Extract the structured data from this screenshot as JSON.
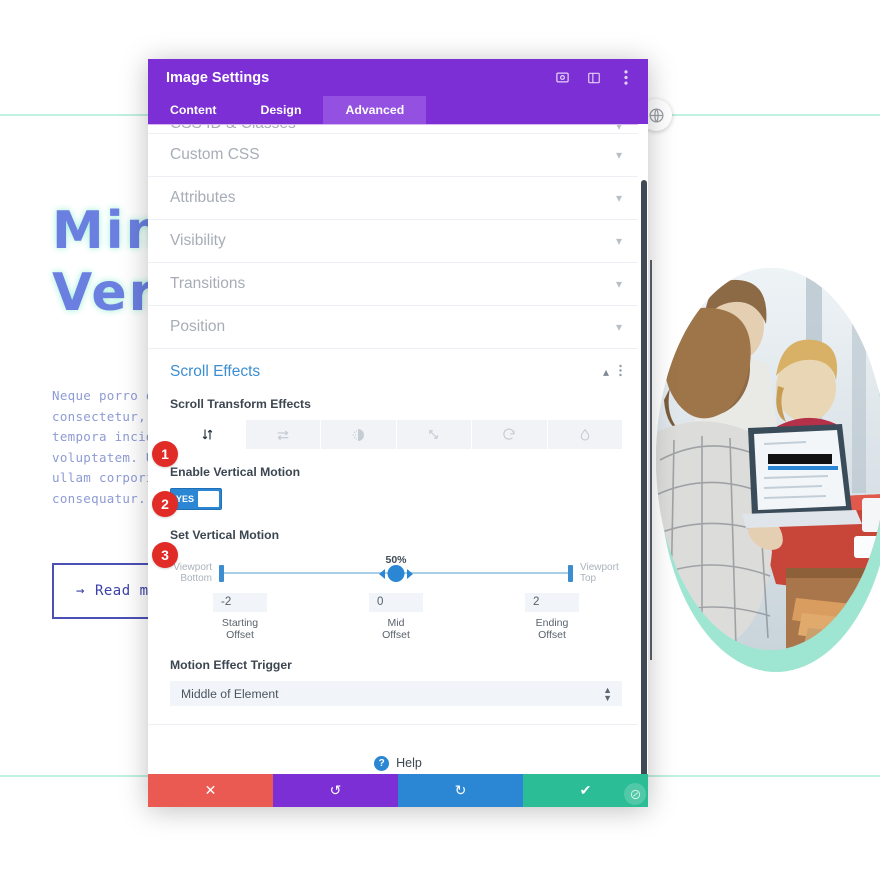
{
  "page": {
    "hero_title": "Min\nVer",
    "hero_body": "Neque porro qui\nconsectetur, ad\ntempora incidun\nvoluptatem. Ut\nullam corporis\nconsequatur.",
    "read_more_label": "Read  mo",
    "read_more_arrow": "→",
    "globe_icon": "globe-icon",
    "accent_mint": "#9fe6d2",
    "accent_indigo": "#6b7fe0"
  },
  "modal": {
    "title": "Image Settings",
    "header_icons": [
      "target-icon",
      "layout-icon",
      "kebab-menu-icon"
    ],
    "tabs": [
      {
        "label": "Content",
        "active": false
      },
      {
        "label": "Design",
        "active": false
      },
      {
        "label": "Advanced",
        "active": true
      }
    ],
    "sections": [
      {
        "label": "CSS ID & Classes",
        "state": "collapsed"
      },
      {
        "label": "Custom CSS",
        "state": "collapsed"
      },
      {
        "label": "Attributes",
        "state": "collapsed"
      },
      {
        "label": "Visibility",
        "state": "collapsed"
      },
      {
        "label": "Transitions",
        "state": "collapsed"
      },
      {
        "label": "Position",
        "state": "collapsed"
      }
    ],
    "open_section": {
      "label": "Scroll Effects",
      "transform_effects_label": "Scroll Transform Effects",
      "effects": [
        {
          "name": "vertical-motion-icon",
          "active": true
        },
        {
          "name": "horizontal-motion-icon",
          "active": false
        },
        {
          "name": "fade-in-out-icon",
          "active": false
        },
        {
          "name": "scaling-icon",
          "active": false
        },
        {
          "name": "rotating-icon",
          "active": false
        },
        {
          "name": "blur-icon",
          "active": false
        }
      ],
      "enable_label": "Enable Vertical Motion",
      "toggle_value": "YES",
      "set_motion_label": "Set Vertical Motion",
      "slider": {
        "percent": "50%",
        "left_label": "Viewport\nBottom",
        "right_label": "Viewport\nTop"
      },
      "offsets": [
        {
          "value": "-2",
          "caption": "Starting\nOffset"
        },
        {
          "value": "0",
          "caption": "Mid\nOffset"
        },
        {
          "value": "2",
          "caption": "Ending\nOffset"
        }
      ],
      "trigger_label": "Motion Effect Trigger",
      "trigger_value": "Middle of Element"
    },
    "help_label": "Help",
    "help_glyph": "?",
    "footer": [
      {
        "name": "cancel-button",
        "glyph": "✕",
        "color": "#ea5a52"
      },
      {
        "name": "undo-button",
        "glyph": "↺",
        "color": "#7b2fd4"
      },
      {
        "name": "redo-button",
        "glyph": "↻",
        "color": "#2b87d3"
      },
      {
        "name": "save-button",
        "glyph": "✔",
        "color": "#2bbd95"
      }
    ]
  },
  "callouts": [
    {
      "number": "1"
    },
    {
      "number": "2"
    },
    {
      "number": "3"
    }
  ]
}
